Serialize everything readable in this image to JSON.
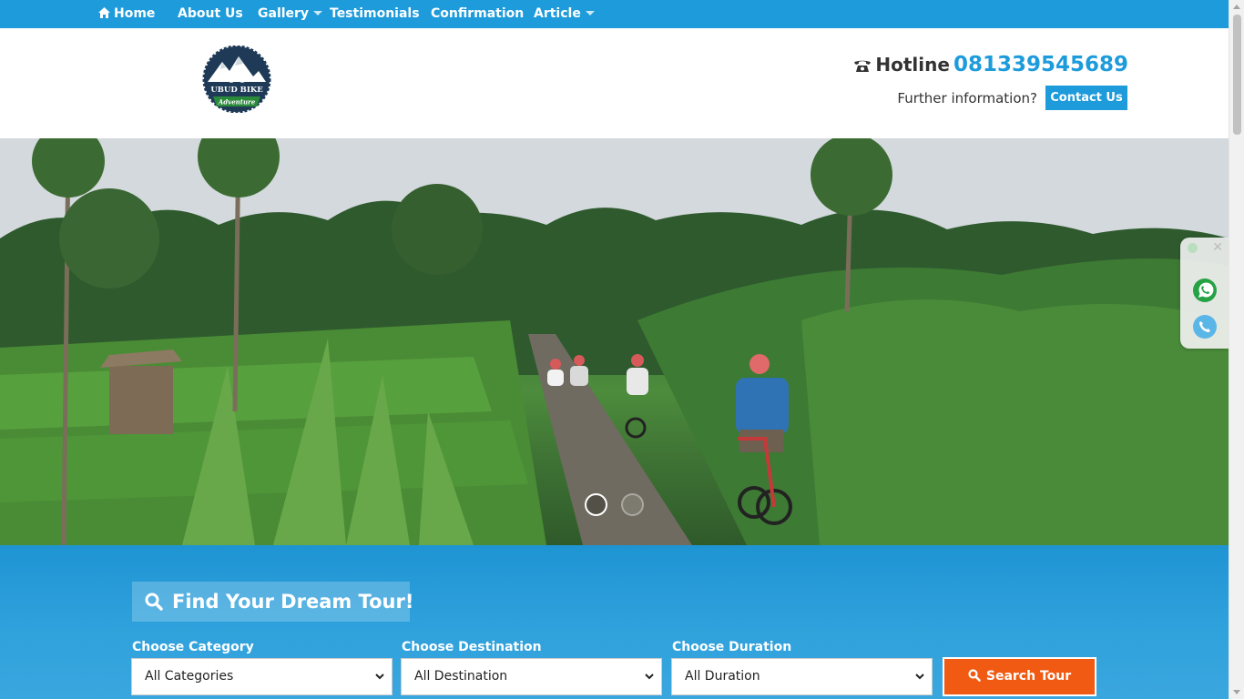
{
  "nav": {
    "items": [
      {
        "label": "Home",
        "icon": "home-icon",
        "has_dropdown": false
      },
      {
        "label": "About Us",
        "has_dropdown": false
      },
      {
        "label": "Gallery",
        "has_dropdown": true
      },
      {
        "label": "Testimonials",
        "has_dropdown": false
      },
      {
        "label": "Confirmation",
        "has_dropdown": false
      },
      {
        "label": "Article",
        "has_dropdown": true
      }
    ]
  },
  "header": {
    "logo_line1": "UBUD BIKE",
    "logo_line2": "Adventure",
    "hotline_label": "Hotline",
    "hotline_number": "081339545689",
    "further_text": "Further information?",
    "contact_label": "Contact Us"
  },
  "slider": {
    "slide_count": 2,
    "active_slide": 1
  },
  "search": {
    "title": "Find Your Dream Tour!",
    "category": {
      "label": "Choose Category",
      "value": "All Categories"
    },
    "destination": {
      "label": "Choose Destination",
      "value": "All Destination"
    },
    "duration": {
      "label": "Choose Duration",
      "value": "All Duration"
    },
    "button_label": "Search Tour"
  },
  "float_widget": {
    "icons": [
      "whatsapp-icon",
      "phone-call-icon"
    ]
  },
  "colors": {
    "primary": "#1d9bdb",
    "search_button": "#f05a12",
    "logo_dark": "#1e3a57",
    "logo_green": "#2a8a3a"
  }
}
